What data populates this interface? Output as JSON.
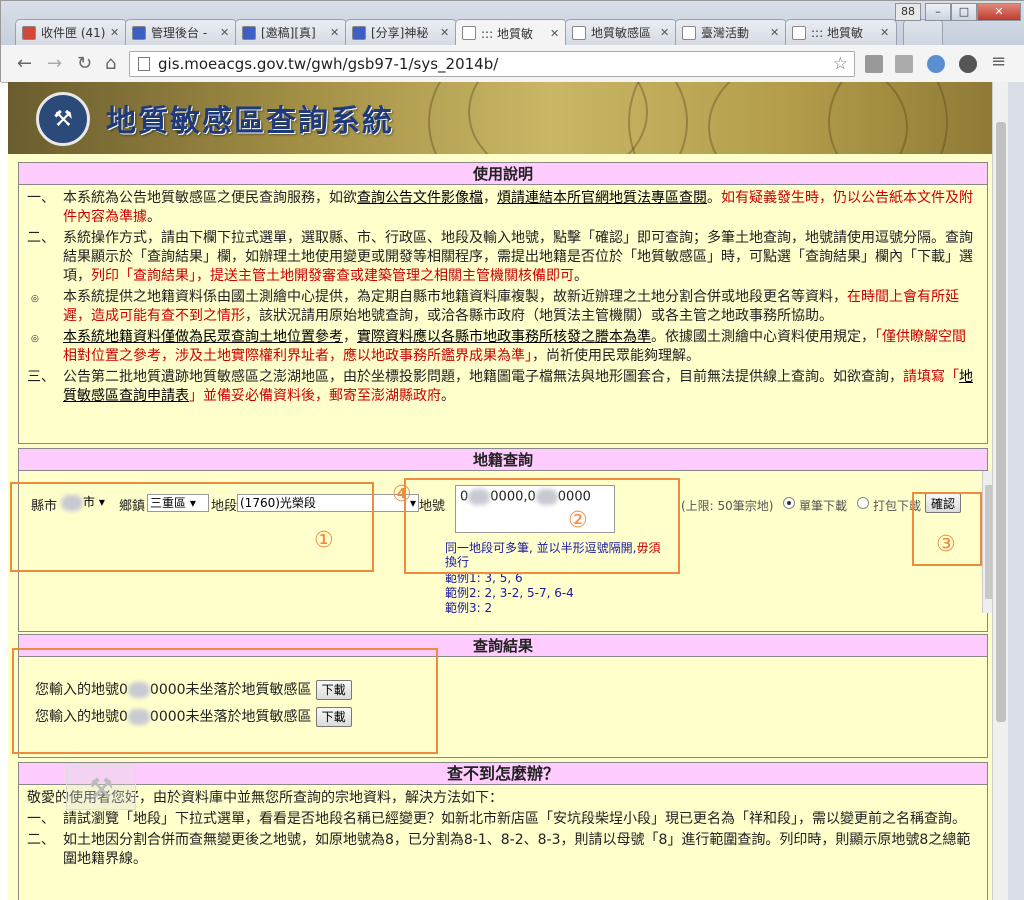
{
  "browser": {
    "profile_badge": "88",
    "tabs": [
      {
        "label": "收件匣 (41)",
        "icon_color": "#d44638"
      },
      {
        "label": "管理後台 -",
        "icon_color": "#3b5fc4"
      },
      {
        "label": "[邀稿][真]",
        "icon_color": "#3b5fc4"
      },
      {
        "label": "[分享]神秘",
        "icon_color": "#3b5fc4"
      },
      {
        "label": "::: 地質敏",
        "icon_color": "#ffffff"
      },
      {
        "label": "地質敏感區",
        "icon_color": "#ffffff"
      },
      {
        "label": "臺灣活動",
        "icon_color": "#ffffff"
      },
      {
        "label": "::: 地質敏",
        "icon_color": "#ffffff"
      }
    ],
    "url": "gis.moeacgs.gov.tw/gwh/gsb97-1/sys_2014b/"
  },
  "site": {
    "title": "地質敏感區查詢系統"
  },
  "usage": {
    "header": "使用說明",
    "items": [
      {
        "num": "一、",
        "parts": [
          {
            "t": "本系統為公告地質敏感區之便民查詢服務，如欲"
          },
          {
            "t": "查詢公告文件影像檔",
            "link": true
          },
          {
            "t": "，"
          },
          {
            "t": "煩請連結本所官網地質法專區查閱",
            "link": true
          },
          {
            "t": "。"
          },
          {
            "t": "如有疑義發生時，仍以公告紙本文件及附件內容為準據",
            "red": true
          },
          {
            "t": "。"
          }
        ]
      },
      {
        "num": "二、",
        "parts": [
          {
            "t": "系統操作方式，請由下欄下拉式選單，選取縣、市、行政區、地段及輸入地號，點擊「確認」即可查詢；多筆土地查詢，地號請使用逗號分隔。查詢結果顯示於「查詢結果」欄，如辦理土地使用變更或開發等相關程序，需提出地籍是否位於「地質敏感區」時，可點選「查詢結果」欄內「下載」選項，"
          },
          {
            "t": "列印「查詢結果」，提送主管土地開發審查或建築管理之相關主管機關核備即可",
            "red": true
          },
          {
            "t": "。"
          }
        ]
      },
      {
        "num": "◎",
        "dot": true,
        "parts": [
          {
            "t": "本系統提供之地籍資料係由國土測繪中心提供，為定期自縣市地籍資料庫複製，故新近辦理之土地分割合併或地段更名等資料，"
          },
          {
            "t": "在時間上會有所延遲，造成可能有查不到之情形",
            "red": true
          },
          {
            "t": "，該狀況請用原始地號查詢，或洽各縣市政府（地質法主管機關）或各主管之地政事務所協助。"
          }
        ]
      },
      {
        "num": "◎",
        "dot": true,
        "parts": [
          {
            "t": "本系統地籍資料僅做為民眾查詢土地位置參考",
            "link": true
          },
          {
            "t": "，"
          },
          {
            "t": "實際資料應以各縣市地政事務所核發之謄本為準",
            "link": true
          },
          {
            "t": "。依據國土測繪中心資料使用規定，"
          },
          {
            "t": "「僅供瞭解空間相對位置之參考，涉及土地實際權利界址者，應以地政事務所鑑界成果為準」",
            "red": true
          },
          {
            "t": "，尚祈使用民眾能夠理解。"
          }
        ]
      },
      {
        "num": "三、",
        "parts": [
          {
            "t": "公告第二批地質遺跡地質敏感區之澎湖地區，由於坐標投影問題，地籍圖電子檔無法與地形圖套合，目前無法提供線上查詢。如欲查詢，"
          },
          {
            "t": "請填寫「",
            "red": true
          },
          {
            "t": "地質敏感區查詢申請表",
            "link": true
          },
          {
            "t": "」並備妥必備資料後，郵寄至澎湖縣政府",
            "red": true
          },
          {
            "t": "。"
          }
        ]
      }
    ]
  },
  "query": {
    "header": "地籍查詢",
    "county_label": "縣市",
    "county_value": "市",
    "district_label": "鄉鎮",
    "district_value": "三重區",
    "section_label": "地段",
    "section_value": "(1760)光榮段",
    "lot_label": "地號",
    "lot_value_a": "0",
    "lot_value_b": "0000,0",
    "lot_value_c": "0000",
    "hint_a": "同一地段可多筆, 並以半形逗號隔開,",
    "hint_b": "毋須",
    "hint_c": "換行",
    "examples": [
      "範例1: 3, 5, 6",
      "範例2: 2, 3-2, 5-7, 6-4",
      "範例3: 2"
    ],
    "limit": "(上限: 50筆宗地)",
    "radio_single": "單筆下載",
    "radio_pack": "打包下載",
    "confirm": "確認",
    "annotations": [
      "①",
      "②",
      "③",
      "④"
    ]
  },
  "results": {
    "header": "查詢結果",
    "rows": [
      {
        "prefix": "您輸入的地號0",
        "suffix": "0000未坐落於地質敏感區",
        "button": "下載"
      },
      {
        "prefix": "您輸入的地號0",
        "suffix": "0000未坐落於地質敏感區",
        "button": "下載"
      }
    ]
  },
  "help": {
    "header": "查不到怎麼辦？",
    "intro": "敬愛的使用者您好，由於資料庫中並無您所查詢的宗地資料，解決方法如下：",
    "items": [
      {
        "num": "一、",
        "text": "請試瀏覽「地段」下拉式選單，看看是否地段名稱已經變更？如新北市新店區「安坑段柴埕小段」現已更名為「祥和段」，需以變更前之名稱查詢。"
      },
      {
        "num": "二、",
        "text": "如土地因分割合併而查無變更後之地號，如原地號為8，已分割為8-1、8-2、8-3，則請以母號「8」進行範圍查詢。列印時，則顯示原地號8之總範圍地籍界線。"
      }
    ]
  }
}
